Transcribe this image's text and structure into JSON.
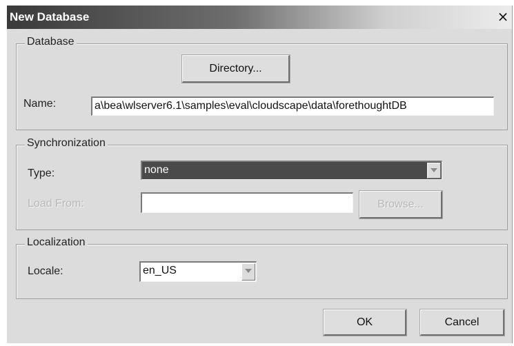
{
  "window": {
    "title": "New Database",
    "close_label": "×"
  },
  "database": {
    "legend": "Database",
    "directory_button": "Directory...",
    "name_label": "Name:",
    "name_value": "a\\bea\\wlserver6.1\\samples\\eval\\cloudscape\\data\\forethoughtDB"
  },
  "synchronization": {
    "legend": "Synchronization",
    "type_label": "Type:",
    "type_value": "none",
    "load_from_label": "Load From:",
    "load_from_value": "",
    "browse_button": "Browse..."
  },
  "localization": {
    "legend": "Localization",
    "locale_label": "Locale:",
    "locale_value": "en_US"
  },
  "buttons": {
    "ok": "OK",
    "cancel": "Cancel"
  },
  "colors": {
    "selected_bg": "#4a4a4a",
    "dialog_bg": "#dcdcdc"
  }
}
